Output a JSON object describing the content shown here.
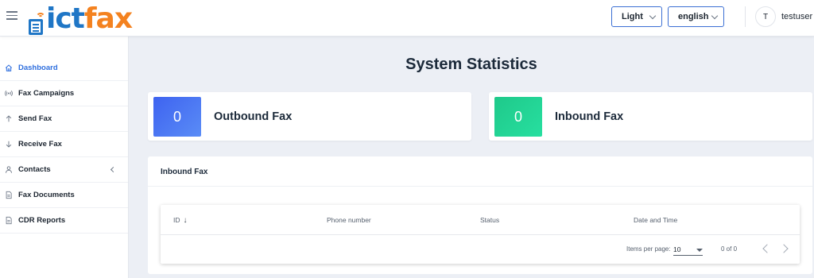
{
  "header": {
    "logo_part1": "ict",
    "logo_part2": "fax",
    "theme_select": "Light",
    "language_select": "english",
    "avatar_initial": "T",
    "username": "testuser"
  },
  "sidebar": {
    "items": [
      {
        "label": "Dashboard",
        "icon": "home-icon",
        "active": true
      },
      {
        "label": "Fax Campaigns",
        "icon": "broadcast-icon"
      },
      {
        "label": "Send Fax",
        "icon": "arrow-up-icon"
      },
      {
        "label": "Receive Fax",
        "icon": "arrow-down-icon"
      },
      {
        "label": "Contacts",
        "icon": "person-icon",
        "expandable": true
      },
      {
        "label": "Fax Documents",
        "icon": "document-icon"
      },
      {
        "label": "CDR Reports",
        "icon": "document-icon"
      }
    ]
  },
  "main": {
    "title": "System Statistics",
    "stats": {
      "outbound": {
        "value": "0",
        "label": "Outbound Fax",
        "color": "#4a73f2"
      },
      "inbound": {
        "value": "0",
        "label": "Inbound Fax",
        "color": "#22d394"
      }
    },
    "panel": {
      "title": "Inbound Fax",
      "columns": [
        "ID",
        "Phone number",
        "Status",
        "Date and Time"
      ],
      "sort_indicator": "↓",
      "rows": [],
      "paginator": {
        "items_per_page_label": "Items per page:",
        "items_per_page": "10",
        "range": "0 of 0"
      }
    }
  },
  "colors": {
    "accent": "#2f6fde",
    "brand_blue": "#1f76c6",
    "brand_orange": "#f4821f"
  }
}
